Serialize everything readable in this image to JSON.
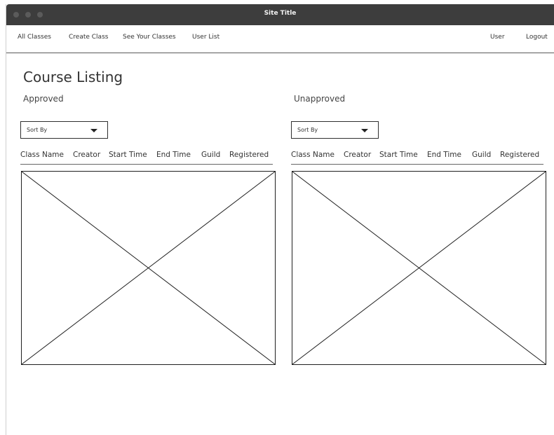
{
  "window": {
    "title": "Site Title"
  },
  "nav": {
    "left": [
      "All Classes",
      "Create Class",
      "See Your Classes",
      "User List"
    ],
    "right": [
      "User",
      "Logout"
    ]
  },
  "page": {
    "title": "Course Listing"
  },
  "approved": {
    "label": "Approved",
    "sort_label": "Sort By",
    "columns": [
      "Class Name",
      "Creator",
      "Start Time",
      "End Time",
      "Guild",
      "Registered"
    ]
  },
  "unapproved": {
    "label": "Unapproved",
    "sort_label": "Sort By",
    "columns": [
      "Class Name",
      "Creator",
      "Start Time",
      "End Time",
      "Guild",
      "Registered"
    ]
  }
}
